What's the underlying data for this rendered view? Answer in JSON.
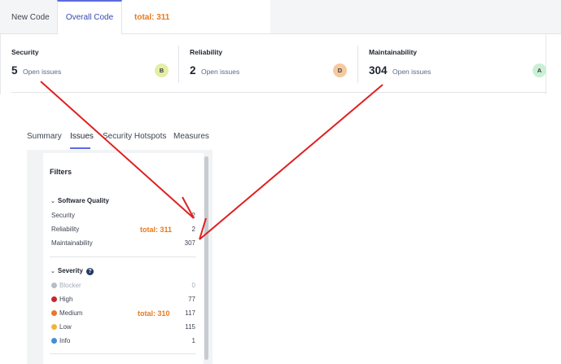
{
  "tabs": {
    "new_code": "New Code",
    "overall_code": "Overall Code",
    "total": "total: 311"
  },
  "metrics": [
    {
      "title": "Security",
      "value": "5",
      "unit": "Open issues",
      "grade": "B",
      "grade_color": "#e4eea5"
    },
    {
      "title": "Reliability",
      "value": "2",
      "unit": "Open issues",
      "grade": "D",
      "grade_color": "#f5c9a0"
    },
    {
      "title": "Maintainability",
      "value": "304",
      "unit": "Open issues",
      "grade": "A",
      "grade_color": "#c9f0d6"
    }
  ],
  "subtabs": [
    "Summary",
    "Issues",
    "Security Hotspots",
    "Measures"
  ],
  "filters": {
    "title": "Filters",
    "software_quality": {
      "label": "Software Quality",
      "items": [
        {
          "label": "Security",
          "count": "2"
        },
        {
          "label": "Reliability",
          "count": "2"
        },
        {
          "label": "Maintainability",
          "count": "307"
        }
      ],
      "total_note": "total: 311"
    },
    "severity": {
      "label": "Severity",
      "help_icon": "?",
      "items": [
        {
          "label": "Blocker",
          "count": "0",
          "color": "#b6bcc8"
        },
        {
          "label": "High",
          "count": "77",
          "color": "#c8262e"
        },
        {
          "label": "Medium",
          "count": "117",
          "color": "#e8762c"
        },
        {
          "label": "Low",
          "count": "115",
          "color": "#f0b43c"
        },
        {
          "label": "Info",
          "count": "1",
          "color": "#3f8fd6"
        }
      ],
      "total_note": "total: 310"
    }
  },
  "colors": {
    "accent": "#5b6be0",
    "annotation": "#e87a1c",
    "arrow": "#e02020"
  }
}
